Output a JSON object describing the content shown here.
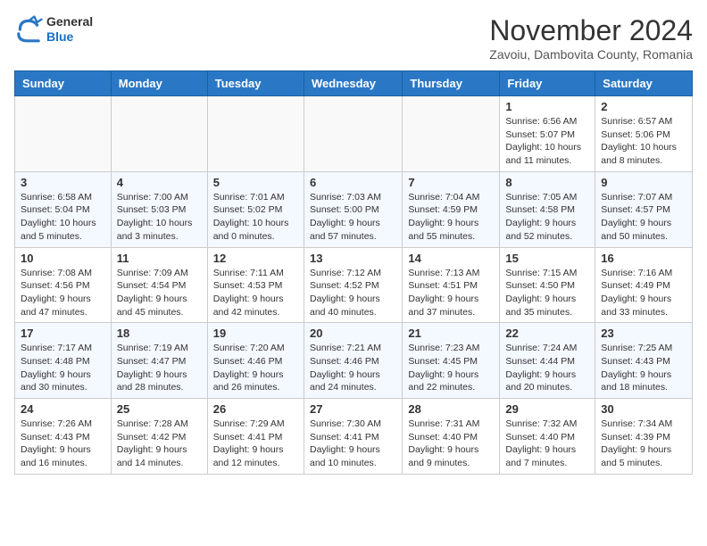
{
  "header": {
    "logo_general": "General",
    "logo_blue": "Blue",
    "month_title": "November 2024",
    "location": "Zavoiu, Dambovita County, Romania"
  },
  "weekdays": [
    "Sunday",
    "Monday",
    "Tuesday",
    "Wednesday",
    "Thursday",
    "Friday",
    "Saturday"
  ],
  "weeks": [
    [
      {
        "day": "",
        "detail": ""
      },
      {
        "day": "",
        "detail": ""
      },
      {
        "day": "",
        "detail": ""
      },
      {
        "day": "",
        "detail": ""
      },
      {
        "day": "",
        "detail": ""
      },
      {
        "day": "1",
        "detail": "Sunrise: 6:56 AM\nSunset: 5:07 PM\nDaylight: 10 hours and 11 minutes."
      },
      {
        "day": "2",
        "detail": "Sunrise: 6:57 AM\nSunset: 5:06 PM\nDaylight: 10 hours and 8 minutes."
      }
    ],
    [
      {
        "day": "3",
        "detail": "Sunrise: 6:58 AM\nSunset: 5:04 PM\nDaylight: 10 hours and 5 minutes."
      },
      {
        "day": "4",
        "detail": "Sunrise: 7:00 AM\nSunset: 5:03 PM\nDaylight: 10 hours and 3 minutes."
      },
      {
        "day": "5",
        "detail": "Sunrise: 7:01 AM\nSunset: 5:02 PM\nDaylight: 10 hours and 0 minutes."
      },
      {
        "day": "6",
        "detail": "Sunrise: 7:03 AM\nSunset: 5:00 PM\nDaylight: 9 hours and 57 minutes."
      },
      {
        "day": "7",
        "detail": "Sunrise: 7:04 AM\nSunset: 4:59 PM\nDaylight: 9 hours and 55 minutes."
      },
      {
        "day": "8",
        "detail": "Sunrise: 7:05 AM\nSunset: 4:58 PM\nDaylight: 9 hours and 52 minutes."
      },
      {
        "day": "9",
        "detail": "Sunrise: 7:07 AM\nSunset: 4:57 PM\nDaylight: 9 hours and 50 minutes."
      }
    ],
    [
      {
        "day": "10",
        "detail": "Sunrise: 7:08 AM\nSunset: 4:56 PM\nDaylight: 9 hours and 47 minutes."
      },
      {
        "day": "11",
        "detail": "Sunrise: 7:09 AM\nSunset: 4:54 PM\nDaylight: 9 hours and 45 minutes."
      },
      {
        "day": "12",
        "detail": "Sunrise: 7:11 AM\nSunset: 4:53 PM\nDaylight: 9 hours and 42 minutes."
      },
      {
        "day": "13",
        "detail": "Sunrise: 7:12 AM\nSunset: 4:52 PM\nDaylight: 9 hours and 40 minutes."
      },
      {
        "day": "14",
        "detail": "Sunrise: 7:13 AM\nSunset: 4:51 PM\nDaylight: 9 hours and 37 minutes."
      },
      {
        "day": "15",
        "detail": "Sunrise: 7:15 AM\nSunset: 4:50 PM\nDaylight: 9 hours and 35 minutes."
      },
      {
        "day": "16",
        "detail": "Sunrise: 7:16 AM\nSunset: 4:49 PM\nDaylight: 9 hours and 33 minutes."
      }
    ],
    [
      {
        "day": "17",
        "detail": "Sunrise: 7:17 AM\nSunset: 4:48 PM\nDaylight: 9 hours and 30 minutes."
      },
      {
        "day": "18",
        "detail": "Sunrise: 7:19 AM\nSunset: 4:47 PM\nDaylight: 9 hours and 28 minutes."
      },
      {
        "day": "19",
        "detail": "Sunrise: 7:20 AM\nSunset: 4:46 PM\nDaylight: 9 hours and 26 minutes."
      },
      {
        "day": "20",
        "detail": "Sunrise: 7:21 AM\nSunset: 4:46 PM\nDaylight: 9 hours and 24 minutes."
      },
      {
        "day": "21",
        "detail": "Sunrise: 7:23 AM\nSunset: 4:45 PM\nDaylight: 9 hours and 22 minutes."
      },
      {
        "day": "22",
        "detail": "Sunrise: 7:24 AM\nSunset: 4:44 PM\nDaylight: 9 hours and 20 minutes."
      },
      {
        "day": "23",
        "detail": "Sunrise: 7:25 AM\nSunset: 4:43 PM\nDaylight: 9 hours and 18 minutes."
      }
    ],
    [
      {
        "day": "24",
        "detail": "Sunrise: 7:26 AM\nSunset: 4:43 PM\nDaylight: 9 hours and 16 minutes."
      },
      {
        "day": "25",
        "detail": "Sunrise: 7:28 AM\nSunset: 4:42 PM\nDaylight: 9 hours and 14 minutes."
      },
      {
        "day": "26",
        "detail": "Sunrise: 7:29 AM\nSunset: 4:41 PM\nDaylight: 9 hours and 12 minutes."
      },
      {
        "day": "27",
        "detail": "Sunrise: 7:30 AM\nSunset: 4:41 PM\nDaylight: 9 hours and 10 minutes."
      },
      {
        "day": "28",
        "detail": "Sunrise: 7:31 AM\nSunset: 4:40 PM\nDaylight: 9 hours and 9 minutes."
      },
      {
        "day": "29",
        "detail": "Sunrise: 7:32 AM\nSunset: 4:40 PM\nDaylight: 9 hours and 7 minutes."
      },
      {
        "day": "30",
        "detail": "Sunrise: 7:34 AM\nSunset: 4:39 PM\nDaylight: 9 hours and 5 minutes."
      }
    ]
  ]
}
